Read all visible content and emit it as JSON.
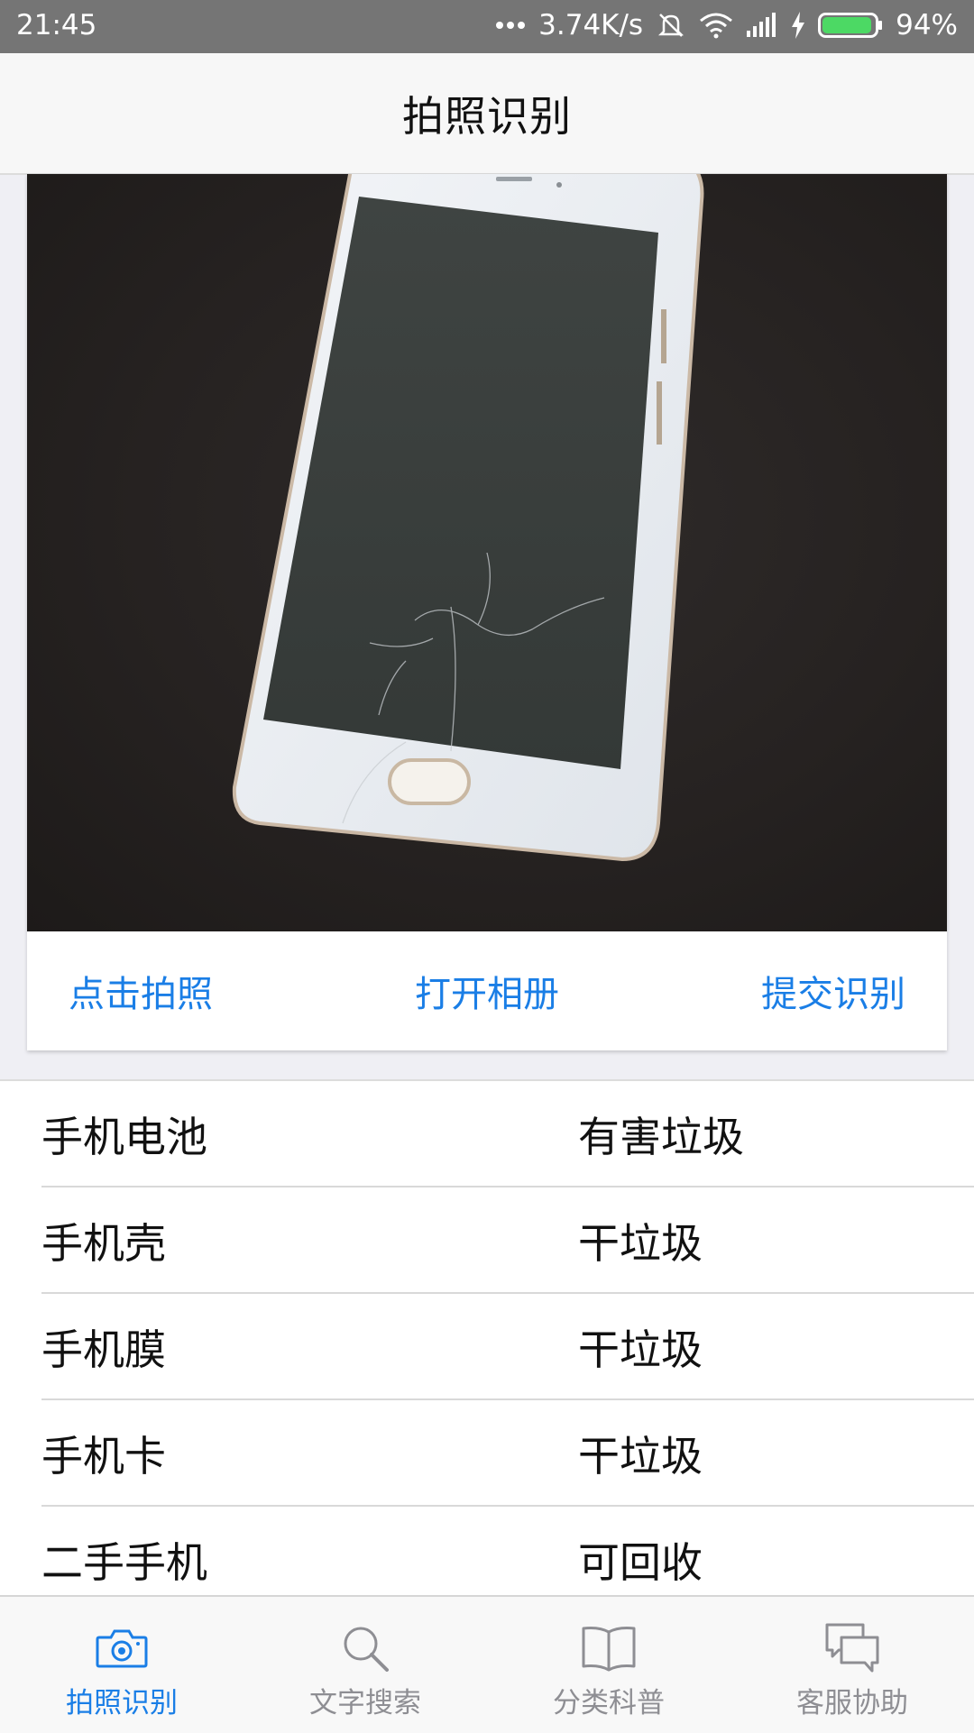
{
  "status_bar": {
    "time": "21:45",
    "speed": "3.74K/s",
    "battery": "94%",
    "battery_level": 0.94
  },
  "header": {
    "title": "拍照识别"
  },
  "photo": {
    "description_icon": "phone-photo"
  },
  "actions": {
    "take_photo": "点击拍照",
    "open_album": "打开相册",
    "submit": "提交识别"
  },
  "results": [
    {
      "name": "手机电池",
      "category": "有害垃圾"
    },
    {
      "name": "手机壳",
      "category": "干垃圾"
    },
    {
      "name": "手机膜",
      "category": "干垃圾"
    },
    {
      "name": "手机卡",
      "category": "干垃圾"
    },
    {
      "name": "二手手机",
      "category": "可回收"
    }
  ],
  "tabs": [
    {
      "label": "拍照识别",
      "icon": "camera-icon",
      "active": true
    },
    {
      "label": "文字搜索",
      "icon": "search-icon",
      "active": false
    },
    {
      "label": "分类科普",
      "icon": "book-icon",
      "active": false
    },
    {
      "label": "客服协助",
      "icon": "chat-icon",
      "active": false
    }
  ],
  "colors": {
    "accent": "#1a7ee6",
    "statusbar": "#757575",
    "battery": "#4cd964"
  }
}
